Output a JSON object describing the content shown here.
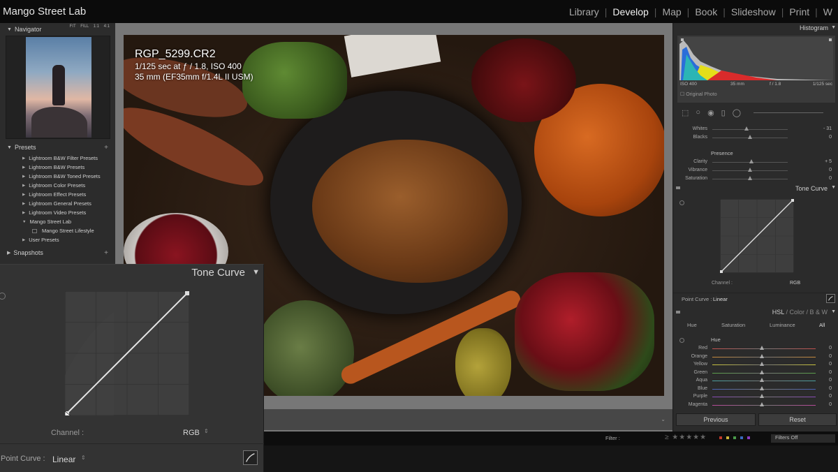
{
  "app": {
    "title": "Mango Street Lab",
    "modules": [
      "Library",
      "Develop",
      "Map",
      "Book",
      "Slideshow",
      "Print",
      "W"
    ],
    "active_module": "Develop"
  },
  "navigator": {
    "title": "Navigator",
    "modes": [
      "FIT",
      "FILL",
      "1:1",
      "4:1"
    ]
  },
  "presets": {
    "title": "Presets",
    "items": [
      {
        "label": "Lightroom B&W Filter Presets",
        "expanded": false
      },
      {
        "label": "Lightroom B&W Presets",
        "expanded": false
      },
      {
        "label": "Lightroom B&W Toned Presets",
        "expanded": false
      },
      {
        "label": "Lightroom Color Presets",
        "expanded": false
      },
      {
        "label": "Lightroom Effect Presets",
        "expanded": false
      },
      {
        "label": "Lightroom General Presets",
        "expanded": false
      },
      {
        "label": "Lightroom Video Presets",
        "expanded": false
      },
      {
        "label": "Mango Street Lab",
        "expanded": true
      },
      {
        "label": "Mango Street Lifestyle",
        "child": true
      },
      {
        "label": "User Presets",
        "expanded": false
      }
    ]
  },
  "snapshots": {
    "title": "Snapshots"
  },
  "photo_info": {
    "filename": "RGP_5299.CR2",
    "exposure": "1/125 sec at ƒ / 1.8, ISO 400",
    "lens": "35 mm (EF35mm f/1.4L II USM)"
  },
  "tone_curve_overlay": {
    "title": "Tone Curve",
    "channel_label": "Channel :",
    "channel_value": "RGB",
    "point_curve_label": "Point Curve :",
    "point_curve_value": "Linear"
  },
  "histogram": {
    "title": "Histogram",
    "iso": "ISO 400",
    "focal": "35 mm",
    "aperture": "f / 1.8",
    "shutter": "1/125 sec",
    "original_photo": "Original Photo"
  },
  "basic_sliders": [
    {
      "label": "Whites",
      "value": "- 31",
      "pos": 0.45
    },
    {
      "label": "Blacks",
      "value": "0",
      "pos": 0.5
    }
  ],
  "presence": {
    "title": "Presence",
    "sliders": [
      {
        "label": "Clarity",
        "value": "+ 5",
        "pos": 0.52
      },
      {
        "label": "Vibrance",
        "value": "0",
        "pos": 0.5
      },
      {
        "label": "Saturation",
        "value": "0",
        "pos": 0.5
      }
    ]
  },
  "tone_curve_panel": {
    "title": "Tone Curve",
    "channel_label": "Channel :",
    "channel_value": "RGB",
    "point_curve_label": "Point Curve :",
    "point_curve_value": "Linear"
  },
  "hsl": {
    "tabs": [
      "HSL",
      "Color",
      "B & W"
    ],
    "active_tab": "HSL",
    "subtabs": [
      "Hue",
      "Saturation",
      "Luminance",
      "All"
    ],
    "section_title": "Hue",
    "colors": [
      {
        "label": "Red",
        "value": "0",
        "color": "#c0504d"
      },
      {
        "label": "Orange",
        "value": "0",
        "color": "#c88a3a"
      },
      {
        "label": "Yellow",
        "value": "0",
        "color": "#c9c33d"
      },
      {
        "label": "Green",
        "value": "0",
        "color": "#5aa04a"
      },
      {
        "label": "Aqua",
        "value": "0",
        "color": "#4aa0a0"
      },
      {
        "label": "Blue",
        "value": "0",
        "color": "#4a63b8"
      },
      {
        "label": "Purple",
        "value": "0",
        "color": "#8a4ab8"
      },
      {
        "label": "Magenta",
        "value": "0",
        "color": "#b84a9a"
      }
    ]
  },
  "buttons": {
    "previous": "Previous",
    "reset": "Reset"
  },
  "filter": {
    "label": "Filter :",
    "stars": "≥ ★★★★★",
    "dots": [
      "#c0392b",
      "#c9b53a",
      "#4a9a4a",
      "#3a6abf",
      "#8a3abf"
    ],
    "value": "Filters Off"
  }
}
